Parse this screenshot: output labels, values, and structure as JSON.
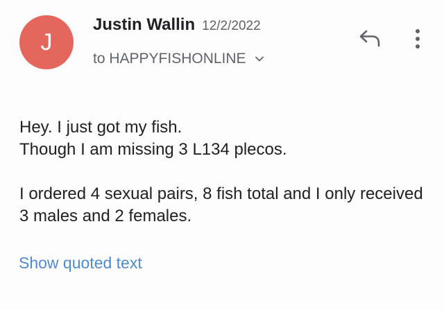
{
  "header": {
    "avatar_initial": "J",
    "avatar_color": "#e5665c",
    "sender_name": "Justin Wallin",
    "date": "12/2/2022",
    "recipient": "to HAPPYFISHONLINE",
    "recipient_toggle_icon": "chevron-down-icon",
    "reply_icon": "reply-icon",
    "more_icon": "more-vert-icon"
  },
  "message": {
    "lines": [
      "Hey. I just got my fish.",
      "Though I am missing 3 L134 plecos.",
      "I ordered 4 sexual pairs, 8 fish total and I only received 3 males and 2 females."
    ]
  },
  "quoted": {
    "label": "Show quoted text",
    "link_color": "#4f8ad1"
  }
}
